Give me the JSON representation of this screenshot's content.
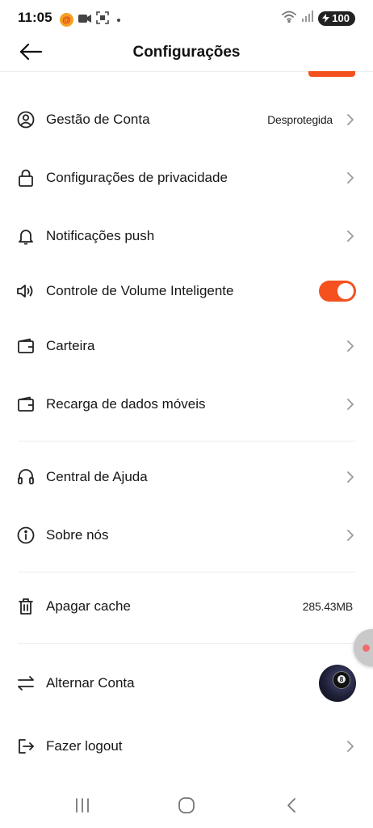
{
  "status_bar": {
    "time": "11:05",
    "app_badge": "@",
    "battery": "100",
    "icons": [
      "notification-app-icon",
      "video-camera-icon",
      "screen-record-icon",
      "dot-icon",
      "wifi-icon",
      "signal-icon",
      "battery-icon"
    ]
  },
  "header": {
    "title": "Configurações",
    "back_icon": "arrow-left-icon"
  },
  "settings": {
    "account": {
      "label": "Gestão de Conta",
      "value": "Desprotegida",
      "icon": "user-circle-icon"
    },
    "privacy": {
      "label": "Configurações de privacidade",
      "icon": "lock-icon"
    },
    "push": {
      "label": "Notificações push",
      "icon": "bell-icon"
    },
    "volume": {
      "label": "Controle de Volume Inteligente",
      "icon": "speaker-icon",
      "enabled": true
    },
    "wallet": {
      "label": "Carteira",
      "icon": "wallet-icon"
    },
    "topup": {
      "label": "Recarga de dados móveis",
      "icon": "wallet-icon"
    },
    "help": {
      "label": "Central de Ajuda",
      "icon": "headset-icon"
    },
    "about": {
      "label": "Sobre nós",
      "icon": "info-icon"
    },
    "cache": {
      "label": "Apagar cache",
      "value": "285.43MB",
      "icon": "trash-icon"
    },
    "switch": {
      "label": "Alternar Conta",
      "icon": "swap-arrows-icon"
    },
    "logout": {
      "label": "Fazer logout",
      "icon": "logout-icon"
    }
  },
  "colors": {
    "accent": "#f4511e",
    "text": "#161616",
    "divider": "#ececec",
    "chevron": "#9a9a9a"
  },
  "nav_bar": {
    "icons": [
      "recent-apps-icon",
      "home-icon",
      "back-icon"
    ]
  }
}
